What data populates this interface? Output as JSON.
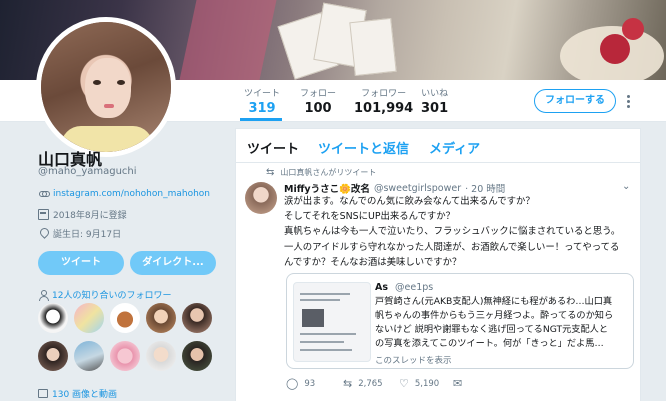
{
  "profile": {
    "name": "山口真帆",
    "handle": "@maho_yamaguchi",
    "url": "instagram.com/nohohon_mahohon",
    "joined": "2018年8月に登録",
    "birthday": "誕生日: 9月17日",
    "tweet_button": "ツイート",
    "dm_button": "ダイレクト...",
    "known_followers": "12人の知り合いのフォロワー",
    "media_count": "130 画像と動画"
  },
  "stats": [
    {
      "label": "ツイート",
      "value": "319"
    },
    {
      "label": "フォロー",
      "value": "100"
    },
    {
      "label": "フォロワー",
      "value": "101,994"
    },
    {
      "label": "いいね",
      "value": "301"
    }
  ],
  "header": {
    "follow_button": "フォローする"
  },
  "tabs": [
    {
      "label": "ツイート"
    },
    {
      "label": "ツイートと返信"
    },
    {
      "label": "メディア"
    }
  ],
  "tweet": {
    "retweet_note": "山口真帆さんがリツイート",
    "author_name": "Miffyうさこ🌼改名",
    "author_handle": "@sweetgirlspower",
    "time": "· 20 時間",
    "lines": [
      "涙が出ます。なんでのん気に飲み会なんて出来るんですか？",
      "そしてそれをSNSにUP出来るんですか？",
      "真帆ちゃんは今も一人で泣いたり、フラッシュバックに悩まされていると思う。",
      "一人のアイドルすら守れなかった人間達が、お酒飲んで楽しいー！ってやってる",
      "んですか？そんなお酒は美味しいですか？"
    ],
    "quote": {
      "author_name": "As",
      "author_handle": "@ee1ps",
      "lines": [
        "戸賀崎さん(元AKB支配人)無神経にも程があるわ…山口真",
        "帆ちゃんの事件からもう三ヶ月経つよ。酔ってるのか知ら",
        "ないけど 説明や謝罪もなく逃げ回ってるNGT元支配人と",
        "の写真を添えてこのツイート。何が「きっと」だよ馬…"
      ],
      "thread_link": "このスレッドを表示"
    },
    "replies": "93",
    "retweets": "2,765",
    "likes": "5,190"
  },
  "colors": {
    "accent": "#1da1f2",
    "button_disabled": "#71c9f8"
  }
}
